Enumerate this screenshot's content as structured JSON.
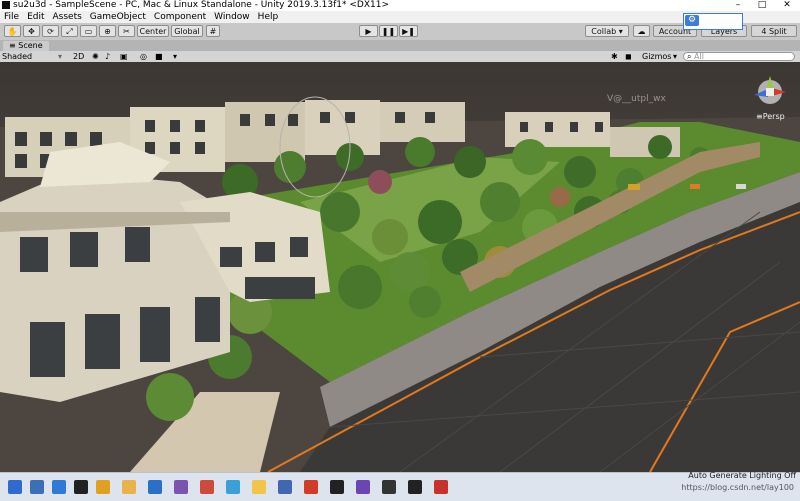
{
  "window": {
    "title": "su2u3d - SampleScene - PC, Mac & Linux Standalone - Unity 2019.3.13f1* <DX11>",
    "controls": [
      "–",
      "□",
      "✕"
    ]
  },
  "menu": [
    "File",
    "Edit",
    "Assets",
    "GameObject",
    "Component",
    "Window",
    "Help"
  ],
  "toolbar": {
    "pivot_label": "Center",
    "space_label": "Global",
    "collab_label": "Collab ▾",
    "account_label": "Account",
    "layers_label": "Layers",
    "layout_label": "4 Split"
  },
  "scene_tab": {
    "label": "Scene"
  },
  "scene_toolbar": {
    "shading_mode": "Shaded",
    "mode_2d": "2D",
    "gizmos_label": "Gizmos",
    "search_placeholder": "All"
  },
  "viewport": {
    "view_label": "≡Persp",
    "overlay_text": "V@__utpl_wx"
  },
  "status": {
    "lighting": "Auto Generate Lighting Off",
    "watermark": "https://blog.csdn.net/lay100"
  },
  "taskbar_icons": [
    {
      "name": "start-icon",
      "color": "#2d6bd1"
    },
    {
      "name": "files-icon",
      "color": "#3b6fb6"
    },
    {
      "name": "edge-icon",
      "color": "#2f7ad4"
    },
    {
      "name": "unity-hub-icon",
      "color": "#222222"
    },
    {
      "name": "chrome-icon",
      "color": "#e0a020"
    },
    {
      "name": "folder-icon",
      "color": "#e9b24a"
    },
    {
      "name": "link-icon",
      "color": "#2a6fc8"
    },
    {
      "name": "photo-icon",
      "color": "#7a55b0"
    },
    {
      "name": "app-icon",
      "color": "#cc4b3a"
    },
    {
      "name": "media-icon",
      "color": "#3aa0d8"
    },
    {
      "name": "notes-icon",
      "color": "#f3c44a"
    },
    {
      "name": "store-icon",
      "color": "#4267b2"
    },
    {
      "name": "sketchup-icon",
      "color": "#d23a2a"
    },
    {
      "name": "unity-icon",
      "color": "#222222"
    },
    {
      "name": "vs-icon",
      "color": "#6c45b5"
    },
    {
      "name": "term-icon",
      "color": "#333333"
    },
    {
      "name": "unity2-icon",
      "color": "#222222"
    },
    {
      "name": "redapp-icon",
      "color": "#c8322a"
    }
  ]
}
